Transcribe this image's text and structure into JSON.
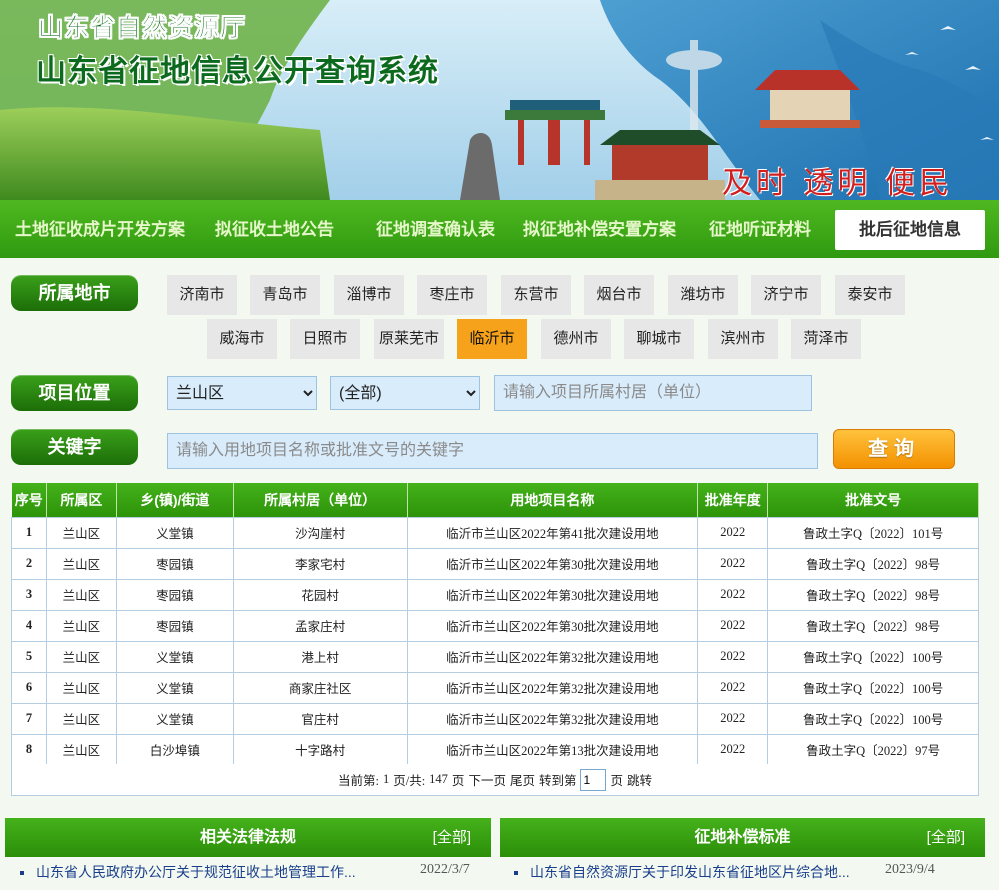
{
  "banner": {
    "org": "山东省自然资源厅",
    "system": "山东省征地信息公开查询系统",
    "slogan": "及时 透明 便民"
  },
  "nav": [
    {
      "label": "土地征收成片开发方案"
    },
    {
      "label": "拟征收土地公告"
    },
    {
      "label": "征地调查确认表"
    },
    {
      "label": "拟征地补偿安置方案"
    },
    {
      "label": "征地听证材料"
    },
    {
      "label": "批后征地信息",
      "active": true
    }
  ],
  "filters": {
    "city_label": "所属地市",
    "cities_row1": [
      "济南市",
      "青岛市",
      "淄博市",
      "枣庄市",
      "东营市",
      "烟台市",
      "潍坊市",
      "济宁市",
      "泰安市"
    ],
    "cities_row2": [
      "威海市",
      "日照市",
      "原莱芜市",
      "临沂市",
      "德州市",
      "聊城市",
      "滨州市",
      "菏泽市"
    ],
    "active_city": "临沂市",
    "location_label": "项目位置",
    "district_value": "兰山区",
    "town_value": "(全部)",
    "village_placeholder": "请输入项目所属村居（单位）",
    "keyword_label": "关键字",
    "keyword_placeholder": "请输入用地项目名称或批准文号的关键字",
    "query_label": "查询"
  },
  "table": {
    "headers": [
      "序号",
      "所属区",
      "乡(镇)/街道",
      "所属村居（单位）",
      "用地项目名称",
      "批准年度",
      "批准文号"
    ],
    "rows": [
      [
        "1",
        "兰山区",
        "义堂镇",
        "沙沟崖村",
        "临沂市兰山区2022年第41批次建设用地",
        "2022",
        "鲁政土字Q〔2022〕101号"
      ],
      [
        "2",
        "兰山区",
        "枣园镇",
        "李家宅村",
        "临沂市兰山区2022年第30批次建设用地",
        "2022",
        "鲁政土字Q〔2022〕98号"
      ],
      [
        "3",
        "兰山区",
        "枣园镇",
        "花园村",
        "临沂市兰山区2022年第30批次建设用地",
        "2022",
        "鲁政土字Q〔2022〕98号"
      ],
      [
        "4",
        "兰山区",
        "枣园镇",
        "孟家庄村",
        "临沂市兰山区2022年第30批次建设用地",
        "2022",
        "鲁政土字Q〔2022〕98号"
      ],
      [
        "5",
        "兰山区",
        "义堂镇",
        "港上村",
        "临沂市兰山区2022年第32批次建设用地",
        "2022",
        "鲁政土字Q〔2022〕100号"
      ],
      [
        "6",
        "兰山区",
        "义堂镇",
        "商家庄社区",
        "临沂市兰山区2022年第32批次建设用地",
        "2022",
        "鲁政土字Q〔2022〕100号"
      ],
      [
        "7",
        "兰山区",
        "义堂镇",
        "官庄村",
        "临沂市兰山区2022年第32批次建设用地",
        "2022",
        "鲁政土字Q〔2022〕100号"
      ],
      [
        "8",
        "兰山区",
        "白沙埠镇",
        "十字路村",
        "临沂市兰山区2022年第13批次建设用地",
        "2022",
        "鲁政土字Q〔2022〕97号"
      ]
    ]
  },
  "pager": {
    "current_prefix": "当前第:",
    "current_page": "1",
    "page_total_text": "页/共:",
    "total_pages": "147",
    "page_unit": "页",
    "next": "下一页",
    "last": "尾页",
    "goto_prefix": "转到第",
    "goto_value": "1",
    "goto_suffix": "页",
    "jump": "跳转"
  },
  "panels": {
    "laws": {
      "title": "相关法律法规",
      "more": "[全部]",
      "item": "山东省人民政府办公厅关于规范征收土地管理工作...",
      "date": "2022/3/7"
    },
    "compensation": {
      "title": "征地补偿标准",
      "more": "[全部]",
      "item": "山东省自然资源厅关于印发山东省征地区片综合地...",
      "date": "2023/9/4"
    }
  },
  "colors": {
    "nav_green": "#3aa716",
    "label_green": "#2a8a10",
    "active_city": "#f6a21a",
    "query_orange": "#f9a81c",
    "slogan_red": "#d11f1f"
  }
}
